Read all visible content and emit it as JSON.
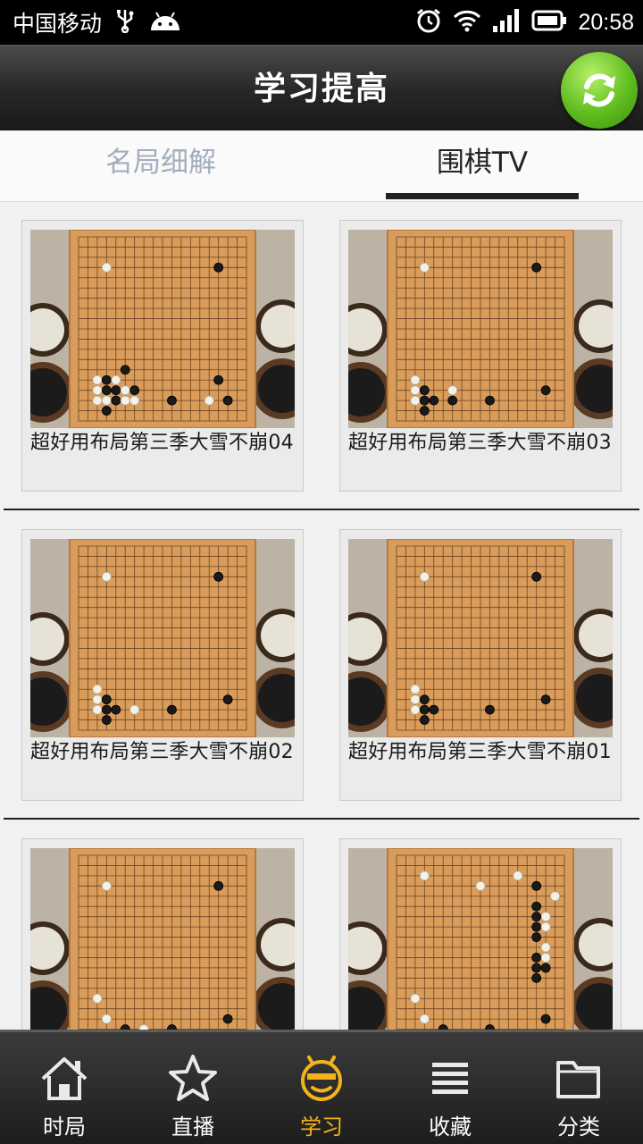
{
  "status_bar": {
    "carrier": "中国移动",
    "time": "20:58"
  },
  "header": {
    "title": "学习提高",
    "refresh_icon": "refresh-icon"
  },
  "tabs": [
    {
      "label": "名局细解",
      "selected": false
    },
    {
      "label": "围棋TV",
      "selected": true
    }
  ],
  "videos": [
    {
      "title": "超好用布局第三季大雪不崩04"
    },
    {
      "title": "超好用布局第三季大雪不崩03"
    },
    {
      "title": "超好用布局第三季大雪不崩02"
    },
    {
      "title": "超好用布局第三季大雪不崩01"
    },
    {
      "title": ""
    },
    {
      "title": ""
    }
  ],
  "bottom_nav": [
    {
      "label": "时局",
      "icon": "home-icon",
      "active": false
    },
    {
      "label": "直播",
      "icon": "star-icon",
      "active": false
    },
    {
      "label": "学习",
      "icon": "smiley-icon",
      "active": true
    },
    {
      "label": "收藏",
      "icon": "list-icon",
      "active": false
    },
    {
      "label": "分类",
      "icon": "folder-icon",
      "active": false
    }
  ],
  "colors": {
    "accent": "#f2b31b",
    "title_bar": "#262626",
    "tab_inactive": "#a3adbd"
  }
}
